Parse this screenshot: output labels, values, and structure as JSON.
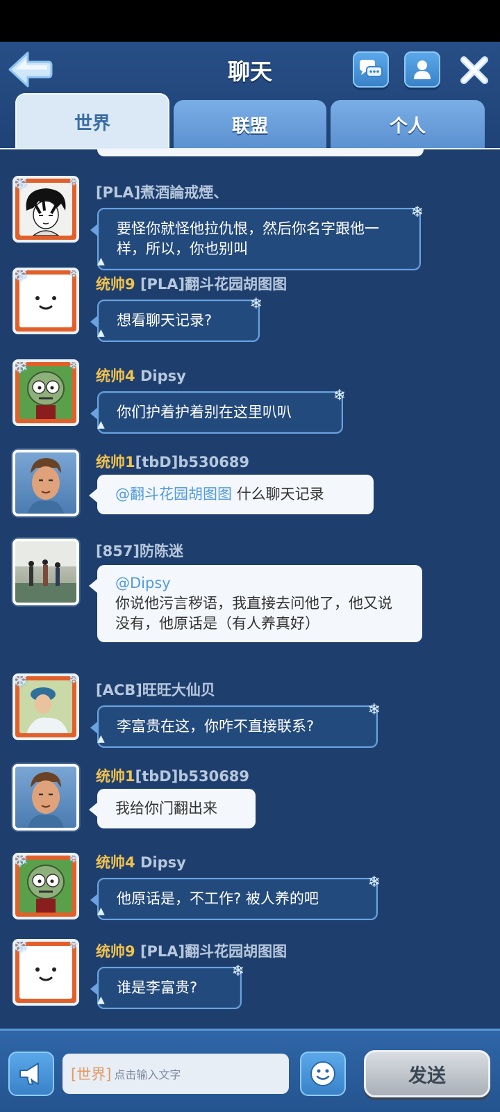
{
  "header": {
    "title": "聊天",
    "colors": {
      "header_bg": "#274e86",
      "chat_bg": "#1e3f6e",
      "rank": "#f2c24e",
      "mention": "#4f9be0"
    }
  },
  "tabs": [
    {
      "label": "世界",
      "active": true
    },
    {
      "label": "联盟",
      "active": false
    },
    {
      "label": "个人",
      "active": false
    }
  ],
  "messages": [
    {
      "rank": "",
      "sender": "[PLA]煮酒論戒煙、",
      "avatar": "anime-boy",
      "style": "dark",
      "mention": "",
      "text": "要怪你就怪他拉仇恨，然后你名字跟他一样，所以，你也别叫"
    },
    {
      "rank": "统帅9",
      "sender": "[PLA]翻斗花园胡图图",
      "avatar": "marshmallow",
      "style": "dark",
      "mention": "",
      "text": "想看聊天记录?"
    },
    {
      "rank": "统帅4",
      "sender": "Dipsy",
      "avatar": "zombie",
      "style": "dark",
      "mention": "",
      "text": "你们护着护着别在这里叭叭"
    },
    {
      "rank": "统帅1",
      "sender": "[tbD]b530689",
      "avatar": "hero",
      "style": "light",
      "mention": "@翻斗花园胡图图",
      "text": "什么聊天记录"
    },
    {
      "rank": "",
      "sender": "[857]防陈迷",
      "avatar": "photo",
      "style": "light",
      "mention": "@Dipsy",
      "text": "你说他污言秽语，我直接去问他了，他又说没有，他原话是（有人养真好）"
    },
    {
      "rank": "",
      "sender": "[ACB]旺旺大仙贝",
      "avatar": "girl-photo",
      "style": "dark",
      "mention": "",
      "text": "李富贵在这，你咋不直接联系?"
    },
    {
      "rank": "统帅1",
      "sender": "[tbD]b530689",
      "avatar": "hero",
      "style": "light",
      "mention": "",
      "text": "我给你门翻出来"
    },
    {
      "rank": "统帅4",
      "sender": "Dipsy",
      "avatar": "zombie",
      "style": "dark",
      "mention": "",
      "text": "他原话是，不工作? 被人养的吧"
    },
    {
      "rank": "统帅9",
      "sender": "[PLA]翻斗花园胡图图",
      "avatar": "marshmallow",
      "style": "dark",
      "mention": "",
      "text": "谁是李富贵?"
    }
  ],
  "input": {
    "channel_tag": "[世界]",
    "placeholder": "点击输入文字",
    "send_label": "发送"
  },
  "icons": {
    "back": "back-arrow-icon",
    "chat": "chat-bubbles-icon",
    "profile": "profile-icon",
    "close": "close-icon",
    "horn": "megaphone-icon",
    "emoji": "emoji-icon"
  }
}
